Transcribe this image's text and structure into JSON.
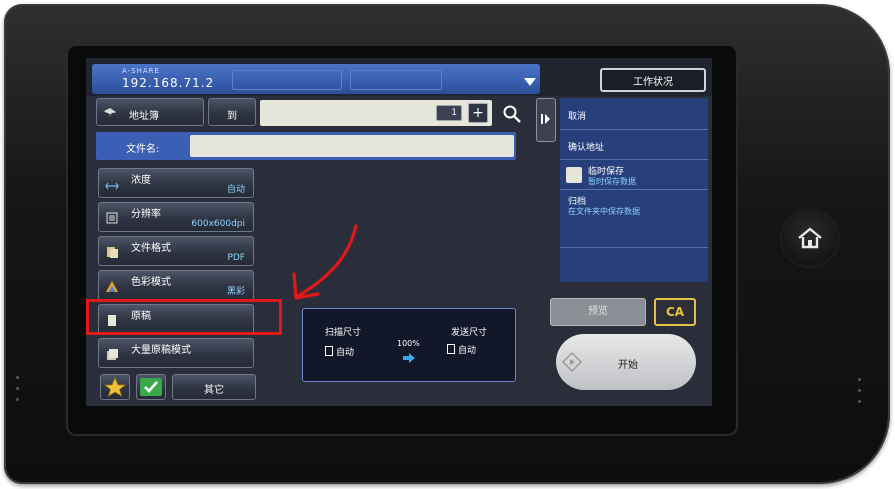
{
  "header": {
    "share_label": "A-SHARE",
    "ip_address": "192.168.71.2",
    "job_status": "工作状况"
  },
  "toolbar": {
    "address_book": "地址簿",
    "to": "到",
    "dest_count": "1",
    "plus": "+"
  },
  "filename": {
    "label": "文件名:"
  },
  "right_panel": {
    "cancel": "取消",
    "confirm_address": "确认地址",
    "temp_save_title": "临时保存",
    "temp_save_sub": "暂时保存数据",
    "archive_title": "归档",
    "archive_sub": "在文件夹中保存数据"
  },
  "settings": [
    {
      "label": "浓度",
      "value": "自动"
    },
    {
      "label": "分辨率",
      "value": "600x600dpi"
    },
    {
      "label": "文件格式",
      "value": "PDF"
    },
    {
      "label": "色彩模式",
      "value": "黑彩"
    },
    {
      "label": "原稿",
      "value": ""
    },
    {
      "label": "大量原稿模式",
      "value": ""
    }
  ],
  "bottom": {
    "other": "其它"
  },
  "size_panel": {
    "scan_size": "扫描尺寸",
    "scan_value": "自动",
    "ratio": "100%",
    "send_size": "发送尺寸",
    "send_value": "自动"
  },
  "actions": {
    "preview": "预览",
    "ca": "CA",
    "start": "开始"
  },
  "colors": {
    "accent": "#2d4f9c",
    "panel": "#27407c",
    "annotation": "#e01818",
    "ca_border": "#e4c14a"
  }
}
